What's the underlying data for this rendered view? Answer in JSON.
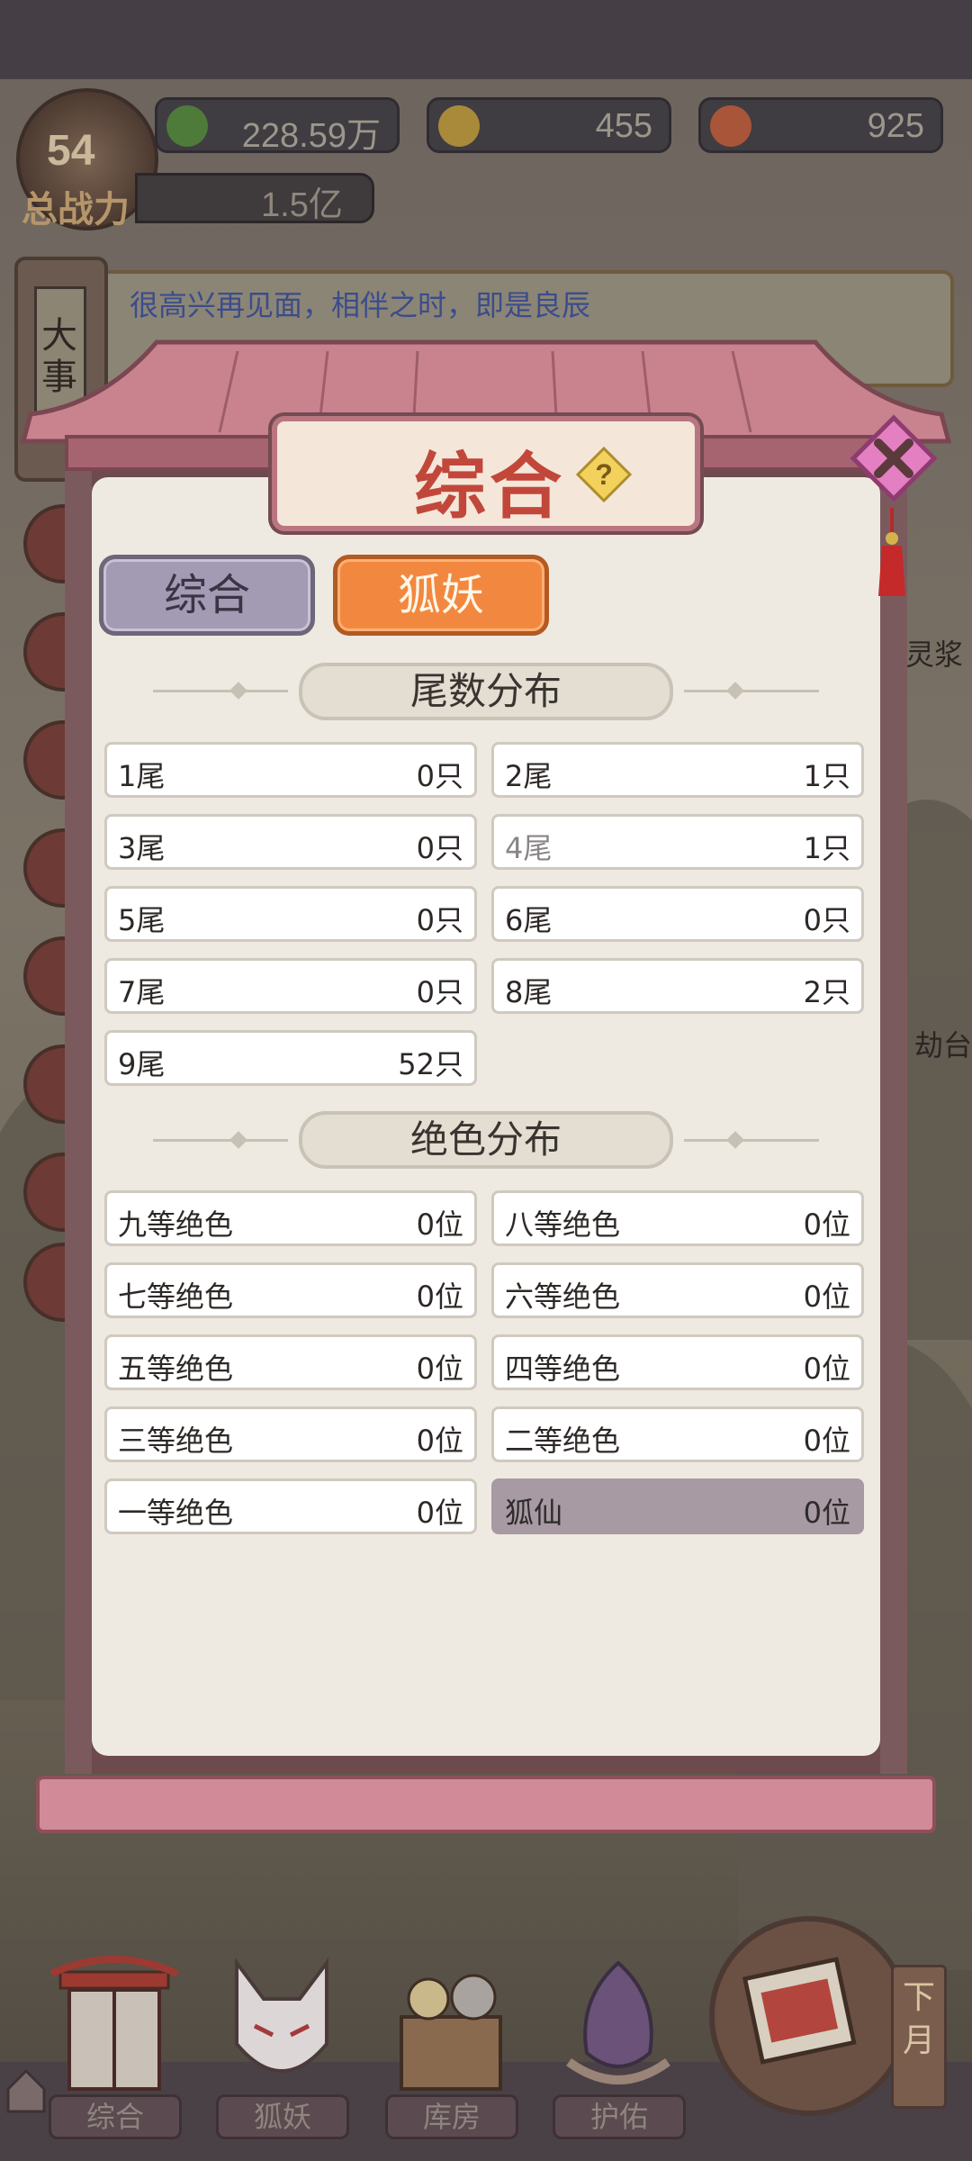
{
  "hud": {
    "currency1": "228.59万",
    "currency2": "455",
    "currency3": "925",
    "level": "54",
    "power_label": "总战力",
    "power_value": "1.5亿"
  },
  "news": {
    "tab_label": "大事记",
    "message": "很高兴再见面，相伴之时，即是良辰"
  },
  "background_labels": {
    "right_top": "灵浆",
    "right_mid": "劫台"
  },
  "modal": {
    "title": "综合",
    "tabs": [
      {
        "label": "综合",
        "active": false
      },
      {
        "label": "狐妖",
        "active": true
      }
    ],
    "tail_section": {
      "header": "尾数分布",
      "items": [
        {
          "label": "1尾",
          "value": "0只"
        },
        {
          "label": "2尾",
          "value": "1只"
        },
        {
          "label": "3尾",
          "value": "0只"
        },
        {
          "label": "4尾",
          "value": "1只"
        },
        {
          "label": "5尾",
          "value": "0只"
        },
        {
          "label": "6尾",
          "value": "0只"
        },
        {
          "label": "7尾",
          "value": "0只"
        },
        {
          "label": "8尾",
          "value": "2只"
        },
        {
          "label": "9尾",
          "value": "52只"
        }
      ]
    },
    "beauty_section": {
      "header": "绝色分布",
      "items": [
        {
          "label": "九等绝色",
          "value": "0位"
        },
        {
          "label": "八等绝色",
          "value": "0位"
        },
        {
          "label": "七等绝色",
          "value": "0位"
        },
        {
          "label": "六等绝色",
          "value": "0位"
        },
        {
          "label": "五等绝色",
          "value": "0位"
        },
        {
          "label": "四等绝色",
          "value": "0位"
        },
        {
          "label": "三等绝色",
          "value": "0位"
        },
        {
          "label": "二等绝色",
          "value": "0位"
        },
        {
          "label": "一等绝色",
          "value": "0位"
        },
        {
          "label": "狐仙",
          "value": "0位"
        }
      ]
    }
  },
  "bottom_nav": [
    {
      "label": "综合",
      "icon": "gate-icon"
    },
    {
      "label": "狐妖",
      "icon": "fox-mask-icon"
    },
    {
      "label": "库房",
      "icon": "storehouse-icon"
    },
    {
      "label": "护佑",
      "icon": "lotus-icon"
    }
  ],
  "calendar": {
    "next_label": "下月",
    "icon": "calendar-icon"
  },
  "colors": {
    "accent_orange": "#f2883f",
    "title_red": "#c2473b",
    "modal_frame": "#b97580",
    "highlight_cell": "#a79aa3"
  }
}
